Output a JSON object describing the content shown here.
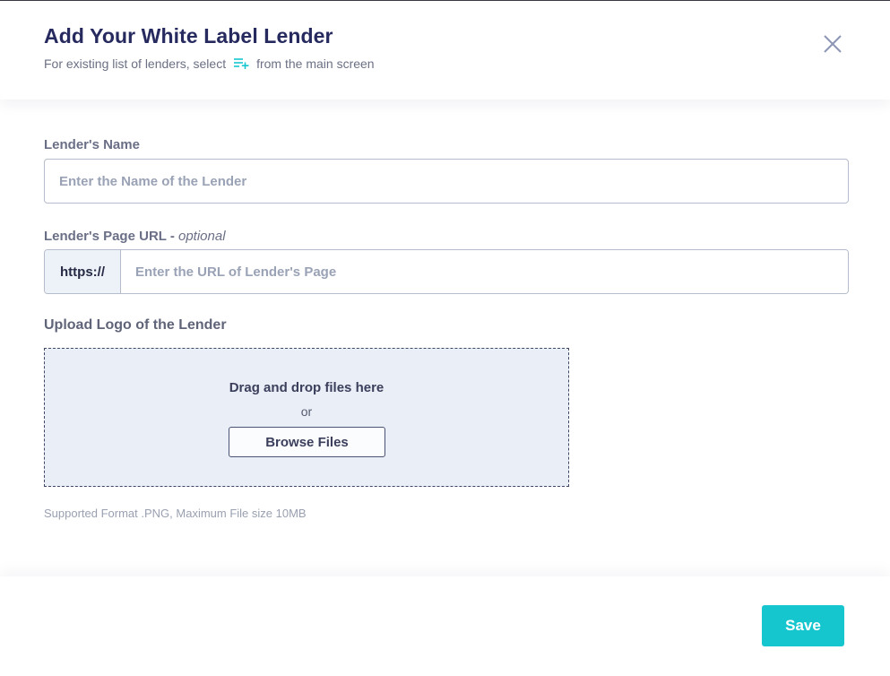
{
  "header": {
    "title": "Add Your White Label Lender",
    "subtitle_before": "For existing list of lenders, select",
    "subtitle_icon": "list-add-icon",
    "subtitle_after": "from the main screen",
    "close_icon": "close-icon"
  },
  "form": {
    "lender_name": {
      "label": "Lender's Name",
      "value": "",
      "placeholder": "Enter the Name of the Lender"
    },
    "lender_url": {
      "label": "Lender's Page URL - ",
      "optional": "optional",
      "prefix": "https://",
      "value": "",
      "placeholder": "Enter the URL of Lender's Page"
    },
    "logo_upload": {
      "label": "Upload Logo of the Lender",
      "drop_text": "Drag and drop files here",
      "or_text": "or",
      "browse_label": "Browse Files",
      "hint": "Supported Format .PNG, Maximum File size 10MB"
    }
  },
  "footer": {
    "save_label": "Save"
  },
  "colors": {
    "title": "#262a5e",
    "accent": "#16c6cf",
    "dropzone_bg": "#eaeef6",
    "input_border": "#b5bccb"
  }
}
